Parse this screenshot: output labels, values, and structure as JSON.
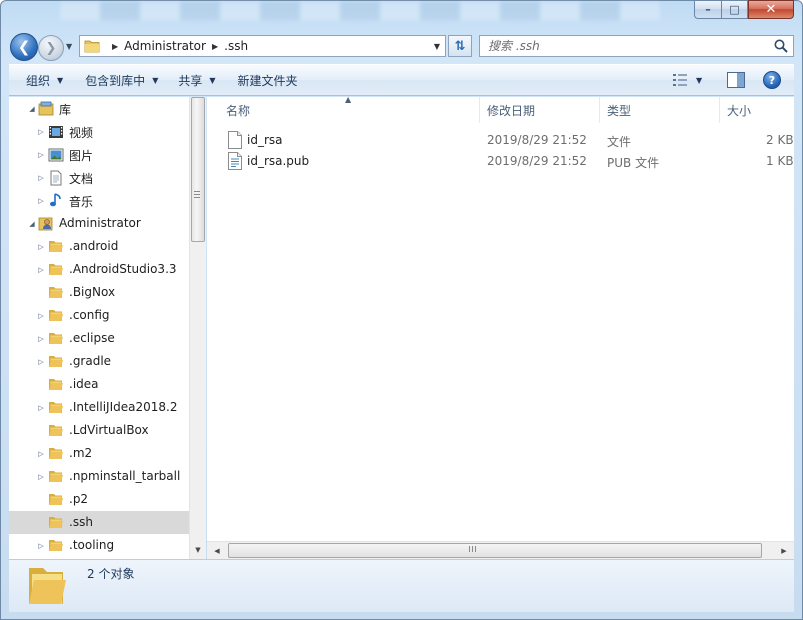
{
  "window": {
    "caption_minimize": "–",
    "caption_maximize": "□",
    "caption_close": "✕"
  },
  "address": {
    "crumbs": [
      "Administrator",
      ".ssh"
    ],
    "search_placeholder": "搜索 .ssh"
  },
  "commands": {
    "organize": "组织",
    "include_in_library": "包含到库中",
    "share": "共享",
    "new_folder": "新建文件夹"
  },
  "nav_tree": {
    "items": [
      {
        "label": "库",
        "icon": "library-icon",
        "expanded": true,
        "level": 0
      },
      {
        "label": "视频",
        "icon": "video-library-icon",
        "expanded": false,
        "level": 1
      },
      {
        "label": "图片",
        "icon": "pictures-library-icon",
        "expanded": false,
        "level": 1
      },
      {
        "label": "文档",
        "icon": "documents-library-icon",
        "expanded": false,
        "level": 1
      },
      {
        "label": "音乐",
        "icon": "music-library-icon",
        "expanded": false,
        "level": 1
      },
      {
        "label": "Administrator",
        "icon": "user-folder-icon",
        "expanded": true,
        "level": 0
      },
      {
        "label": ".android",
        "icon": "folder-icon",
        "expanded": false,
        "level": 1
      },
      {
        "label": ".AndroidStudio3.3",
        "icon": "folder-icon",
        "expanded": false,
        "level": 1
      },
      {
        "label": ".BigNox",
        "icon": "folder-icon",
        "expanded": null,
        "level": 1
      },
      {
        "label": ".config",
        "icon": "folder-icon",
        "expanded": false,
        "level": 1
      },
      {
        "label": ".eclipse",
        "icon": "folder-icon",
        "expanded": false,
        "level": 1
      },
      {
        "label": ".gradle",
        "icon": "folder-icon",
        "expanded": false,
        "level": 1
      },
      {
        "label": ".idea",
        "icon": "folder-icon",
        "expanded": null,
        "level": 1
      },
      {
        "label": ".IntelliJIdea2018.2",
        "icon": "folder-icon",
        "expanded": false,
        "level": 1
      },
      {
        "label": ".LdVirtualBox",
        "icon": "folder-icon",
        "expanded": null,
        "level": 1
      },
      {
        "label": ".m2",
        "icon": "folder-icon",
        "expanded": false,
        "level": 1
      },
      {
        "label": ".npminstall_tarball",
        "icon": "folder-icon",
        "expanded": false,
        "level": 1
      },
      {
        "label": ".p2",
        "icon": "folder-icon",
        "expanded": null,
        "level": 1
      },
      {
        "label": ".ssh",
        "icon": "folder-icon",
        "expanded": null,
        "level": 1,
        "selected": true
      },
      {
        "label": ".tooling",
        "icon": "folder-icon",
        "expanded": false,
        "level": 1
      }
    ]
  },
  "file_list": {
    "columns": [
      "名称",
      "修改日期",
      "类型",
      "大小"
    ],
    "rows": [
      {
        "name": "id_rsa",
        "modified": "2019/8/29 21:52",
        "type": "文件",
        "size": "2 KB",
        "icon": "blank-file-icon"
      },
      {
        "name": "id_rsa.pub",
        "modified": "2019/8/29 21:52",
        "type": "PUB 文件",
        "size": "1 KB",
        "icon": "text-file-icon"
      }
    ]
  },
  "status": {
    "count_text": "2 个对象"
  },
  "colors": {
    "frame": "#c9e1f6",
    "folder": "#e8c25a",
    "selected_row": "#d9d9d9",
    "command_text": "#1e395b"
  }
}
